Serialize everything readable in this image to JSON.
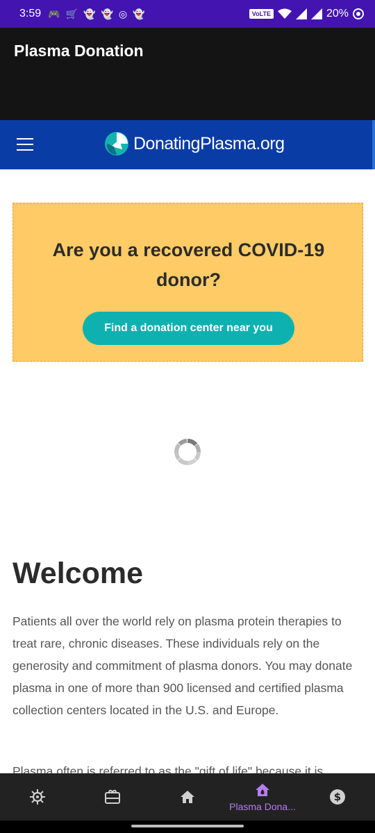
{
  "status_bar": {
    "time": "3:59",
    "network_badge": "VoLTE",
    "battery": "20%"
  },
  "app_bar": {
    "title": "Plasma Donation"
  },
  "site_header": {
    "logo_text": "DonatingPlasma.org"
  },
  "covid_banner": {
    "title": "Are you a recovered COVID-19 donor?",
    "button_label": "Find a donation center near you"
  },
  "welcome": {
    "heading": "Welcome",
    "paragraph": "Patients all over the world rely on plasma protein therapies to treat rare, chronic diseases. These individuals rely on the generosity and commitment of plasma donors. You may donate plasma in one of more than 900 licensed and certified plasma collection centers located in the U.S. and Europe.",
    "paragraph2": "Plasma often is referred to as the \"gift of life\" because it is"
  },
  "bottom_nav": {
    "items": [
      {
        "icon": "virus-icon"
      },
      {
        "icon": "gift-card-icon"
      },
      {
        "icon": "home-icon"
      },
      {
        "icon": "plasma-home-icon",
        "label": "Plasma Dona..."
      },
      {
        "icon": "dollar-icon"
      }
    ]
  },
  "colors": {
    "status_bar": "#4314b0",
    "header_blue": "#0a3ca6",
    "banner": "#fecb66",
    "button": "#0db2b0",
    "nav_active": "#b77cf0"
  }
}
